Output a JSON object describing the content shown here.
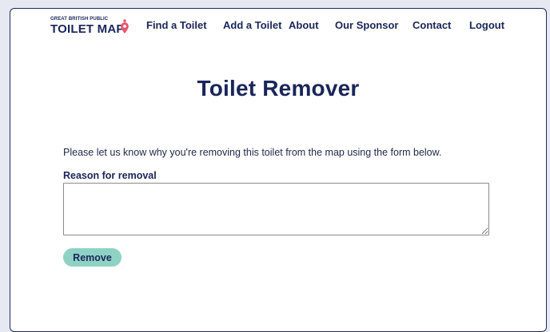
{
  "logo": {
    "top_text": "GREAT BRITISH PUBLIC",
    "main_text": "TOILET MAP",
    "pin_color": "#e8546a"
  },
  "nav": {
    "find": "Find a Toilet",
    "add": "Add a Toilet",
    "about": "About",
    "sponsor": "Our Sponsor",
    "contact": "Contact",
    "logout": "Logout"
  },
  "page": {
    "title": "Toilet Remover",
    "intro": "Please let us know why you're removing this toilet from the map using the form below."
  },
  "form": {
    "reason_label": "Reason for removal",
    "reason_value": "",
    "remove_label": "Remove"
  },
  "colors": {
    "primary_navy": "#1a2559",
    "button_teal": "#8fd2c4",
    "page_background": "#e6e9f2"
  }
}
